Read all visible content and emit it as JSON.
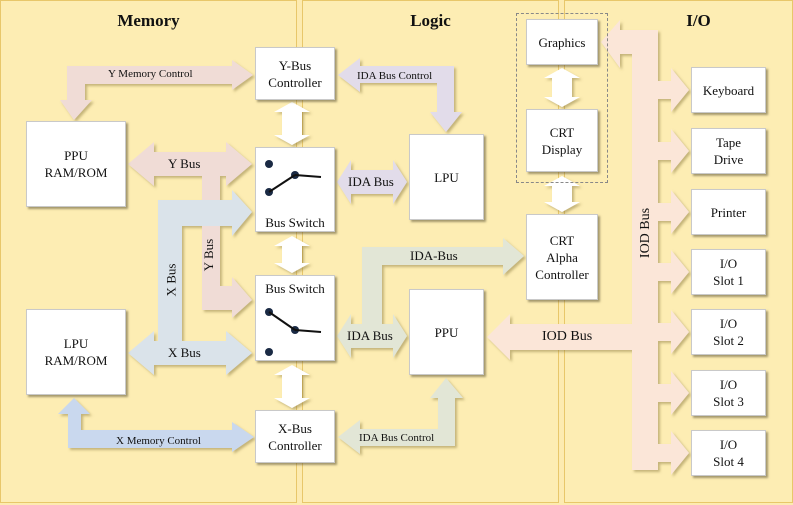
{
  "panels": [
    {
      "id": "memory",
      "title": "Memory"
    },
    {
      "id": "logic",
      "title": "Logic"
    },
    {
      "id": "io",
      "title": "I/O"
    }
  ],
  "blocks": {
    "ppu_ram": "PPU\nRAM/ROM",
    "lpu_ram": "LPU\nRAM/ROM",
    "ybus_ctrl": "Y-Bus\nController",
    "xbus_ctrl": "X-Bus\nController",
    "bus_switch_top": "Bus Switch",
    "bus_switch_bottom": "Bus Switch",
    "lpu": "LPU",
    "ppu": "PPU",
    "graphics": "Graphics",
    "crt_display": "CRT\nDisplay",
    "crt_alpha": "CRT\nAlpha\nController",
    "keyboard": "Keyboard",
    "tape_drive": "Tape\nDrive",
    "printer": "Printer",
    "io_slot1": "I/O\nSlot 1",
    "io_slot2": "I/O\nSlot 2",
    "io_slot3": "I/O\nSlot 3",
    "io_slot4": "I/O\nSlot 4"
  },
  "connections": {
    "y_memory_control": "Y Memory Control",
    "x_memory_control": "X Memory Control",
    "ida_bus_control_top": "IDA Bus Control",
    "ida_bus_control_bottom": "IDA Bus Control",
    "y_bus_horizontal": "Y Bus",
    "y_bus_vertical": "Y Bus",
    "x_bus_horizontal": "X Bus",
    "x_bus_vertical": "X Bus",
    "ida_bus_top": "IDA Bus",
    "ida_bus_bottom": "IDA Bus",
    "ida_bus_crt": "IDA-Bus",
    "iod_bus_horizontal": "IOD Bus",
    "iod_bus_vertical": "IOD Bus"
  },
  "colors": {
    "y_bus": "#f0dcd6",
    "x_bus": "#dae3ea",
    "x_mem_ctrl": "#c9d8ee",
    "ida_top": "#e2dcea",
    "ida_bottom": "#e2e6d6",
    "iod": "#fbe6d8",
    "white_link": "#ffffff"
  }
}
